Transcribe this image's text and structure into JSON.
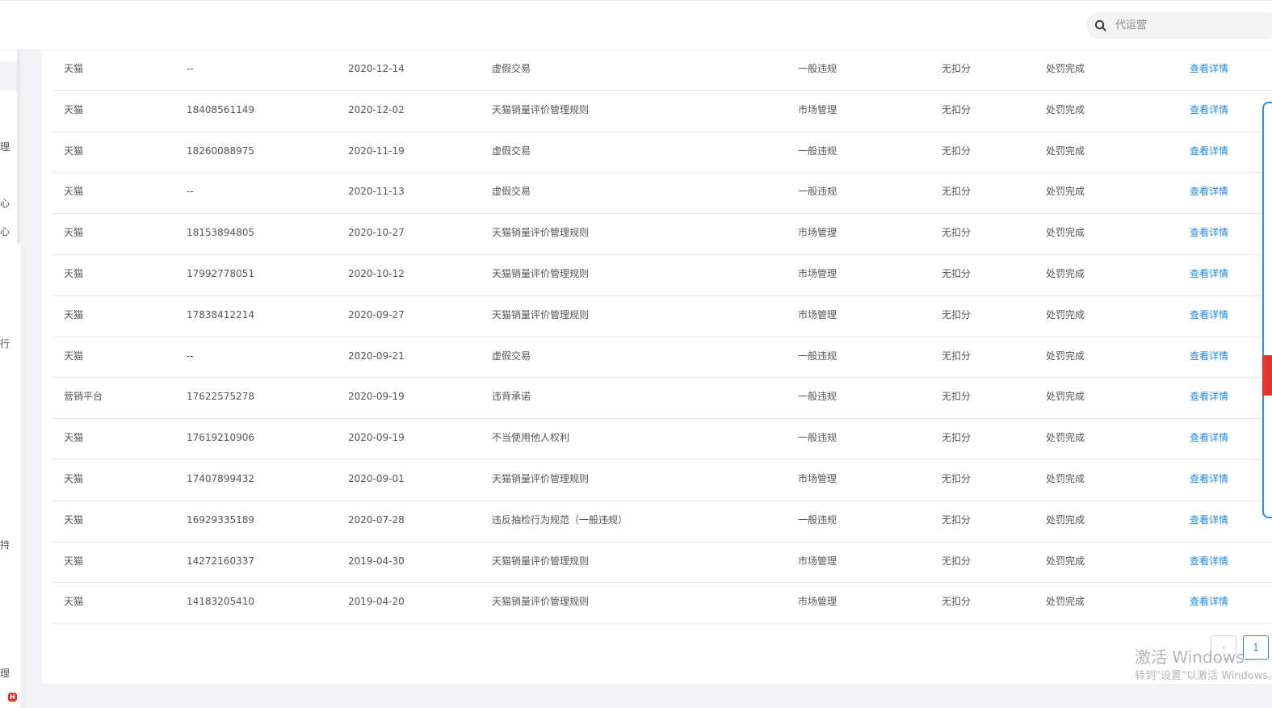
{
  "search": {
    "placeholder": "代运营"
  },
  "sidebar": {
    "fragments": [
      "理",
      "心",
      "心",
      "行",
      "持",
      "理"
    ],
    "badge": "H"
  },
  "table": {
    "rows": [
      {
        "platform": "天猫",
        "number": "--",
        "date": "2020-12-14",
        "rule": "虚假交易",
        "category": "一般违规",
        "deduct": "无扣分",
        "status": "处罚完成",
        "action": "查看详情"
      },
      {
        "platform": "天猫",
        "number": "18408561149",
        "date": "2020-12-02",
        "rule": "天猫销量评价管理规则",
        "category": "市场管理",
        "deduct": "无扣分",
        "status": "处罚完成",
        "action": "查看详情"
      },
      {
        "platform": "天猫",
        "number": "18260088975",
        "date": "2020-11-19",
        "rule": "虚假交易",
        "category": "一般违规",
        "deduct": "无扣分",
        "status": "处罚完成",
        "action": "查看详情"
      },
      {
        "platform": "天猫",
        "number": "--",
        "date": "2020-11-13",
        "rule": "虚假交易",
        "category": "一般违规",
        "deduct": "无扣分",
        "status": "处罚完成",
        "action": "查看详情"
      },
      {
        "platform": "天猫",
        "number": "18153894805",
        "date": "2020-10-27",
        "rule": "天猫销量评价管理规则",
        "category": "市场管理",
        "deduct": "无扣分",
        "status": "处罚完成",
        "action": "查看详情"
      },
      {
        "platform": "天猫",
        "number": "17992778051",
        "date": "2020-10-12",
        "rule": "天猫销量评价管理规则",
        "category": "市场管理",
        "deduct": "无扣分",
        "status": "处罚完成",
        "action": "查看详情"
      },
      {
        "platform": "天猫",
        "number": "17838412214",
        "date": "2020-09-27",
        "rule": "天猫销量评价管理规则",
        "category": "市场管理",
        "deduct": "无扣分",
        "status": "处罚完成",
        "action": "查看详情"
      },
      {
        "platform": "天猫",
        "number": "--",
        "date": "2020-09-21",
        "rule": "虚假交易",
        "category": "一般违规",
        "deduct": "无扣分",
        "status": "处罚完成",
        "action": "查看详情"
      },
      {
        "platform": "营销平台",
        "number": "17622575278",
        "date": "2020-09-19",
        "rule": "违背承诺",
        "category": "一般违规",
        "deduct": "无扣分",
        "status": "处罚完成",
        "action": "查看详情"
      },
      {
        "platform": "天猫",
        "number": "17619210906",
        "date": "2020-09-19",
        "rule": "不当使用他人权利",
        "category": "一般违规",
        "deduct": "无扣分",
        "status": "处罚完成",
        "action": "查看详情"
      },
      {
        "platform": "天猫",
        "number": "17407899432",
        "date": "2020-09-01",
        "rule": "天猫销量评价管理规则",
        "category": "市场管理",
        "deduct": "无扣分",
        "status": "处罚完成",
        "action": "查看详情"
      },
      {
        "platform": "天猫",
        "number": "16929335189",
        "date": "2020-07-28",
        "rule": "违反抽检行为规范（一般违规）",
        "category": "一般违规",
        "deduct": "无扣分",
        "status": "处罚完成",
        "action": "查看详情"
      },
      {
        "platform": "天猫",
        "number": "14272160337",
        "date": "2019-04-30",
        "rule": "天猫销量评价管理规则",
        "category": "市场管理",
        "deduct": "无扣分",
        "status": "处罚完成",
        "action": "查看详情"
      },
      {
        "platform": "天猫",
        "number": "14183205410",
        "date": "2019-04-20",
        "rule": "天猫销量评价管理规则",
        "category": "市场管理",
        "deduct": "无扣分",
        "status": "处罚完成",
        "action": "查看详情"
      }
    ]
  },
  "pagination": {
    "prev": "‹",
    "current_page": "1"
  },
  "watermark": {
    "title": "激活 Windows",
    "subtitle": "转到\"设置\"以激活 Windows。"
  },
  "colors": {
    "link": "#1e88e5",
    "float_border": "#2a8ff7",
    "badge": "#e8322c"
  }
}
